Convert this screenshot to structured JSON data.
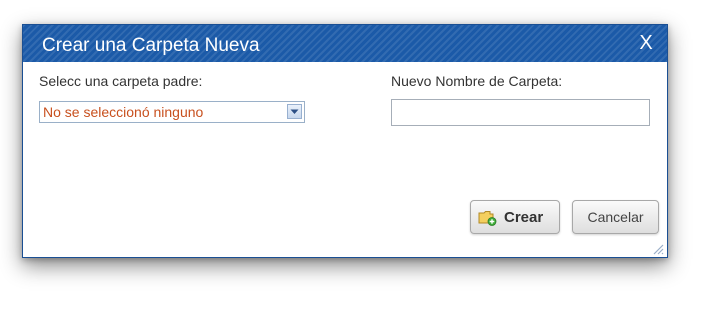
{
  "dialog": {
    "title": "Crear una Carpeta Nueva",
    "close_label": "X"
  },
  "form": {
    "parent_label": "Selecc una carpeta padre:",
    "parent_selected": "No se seleccionó ninguno",
    "name_label": "Nuevo Nombre de Carpeta:",
    "name_value": ""
  },
  "buttons": {
    "create_label": "Crear",
    "cancel_label": "Cancelar"
  },
  "icons": {
    "create": "new-folder-icon",
    "dropdown": "chevron-down-icon",
    "resize": "resize-grip-icon"
  },
  "colors": {
    "titlebar": "#1b5aa8",
    "selected_value": "#c8501e"
  }
}
